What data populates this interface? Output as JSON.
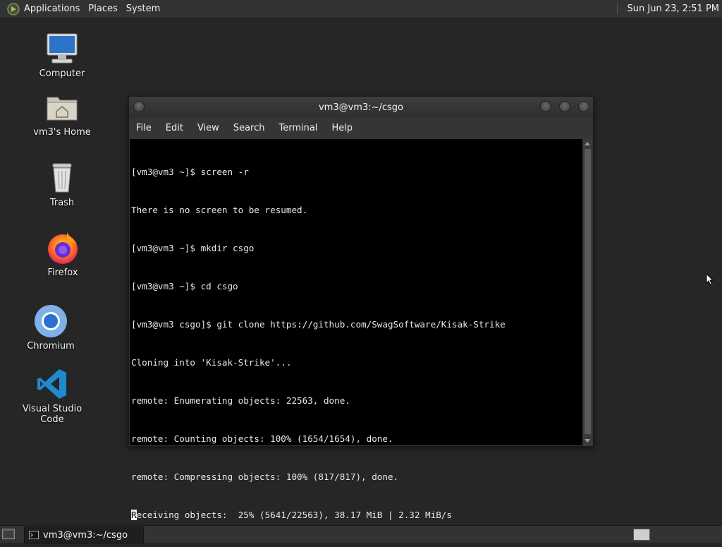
{
  "top_panel": {
    "menus": [
      "Applications",
      "Places",
      "System"
    ],
    "clock": "Sun Jun 23,  2:51 PM"
  },
  "desktop_icons": [
    {
      "label": "Computer",
      "icon": "computer-icon"
    },
    {
      "label": "vm3's Home",
      "icon": "home-folder-icon"
    },
    {
      "label": "Trash",
      "icon": "trash-icon"
    },
    {
      "label": "Firefox",
      "icon": "firefox-icon"
    },
    {
      "label": "Chromium",
      "icon": "chromium-icon"
    },
    {
      "label": "Visual Studio Code",
      "icon": "vscode-icon"
    }
  ],
  "terminal": {
    "title": "vm3@vm3:~/csgo",
    "menu": [
      "File",
      "Edit",
      "View",
      "Search",
      "Terminal",
      "Help"
    ],
    "lines": [
      "[vm3@vm3 ~]$ screen -r",
      "There is no screen to be resumed.",
      "[vm3@vm3 ~]$ mkdir csgo",
      "[vm3@vm3 ~]$ cd csgo",
      "[vm3@vm3 csgo]$ git clone https://github.com/SwagSoftware/Kisak-Strike",
      "Cloning into 'Kisak-Strike'...",
      "remote: Enumerating objects: 22563, done.",
      "remote: Counting objects: 100% (1654/1654), done.",
      "remote: Compressing objects: 100% (817/817), done."
    ],
    "last_line_cursor_char": "R",
    "last_line_rest": "eceiving objects:  25% (5641/22563), 38.17 MiB | 2.32 MiB/s"
  },
  "taskbar": {
    "task_label": "vm3@vm3:~/csgo"
  },
  "colors": {
    "desktop_bg": "#262626",
    "panel_bg": "#333333",
    "terminal_bg": "#000000",
    "terminal_fg": "#e8e8e8"
  }
}
